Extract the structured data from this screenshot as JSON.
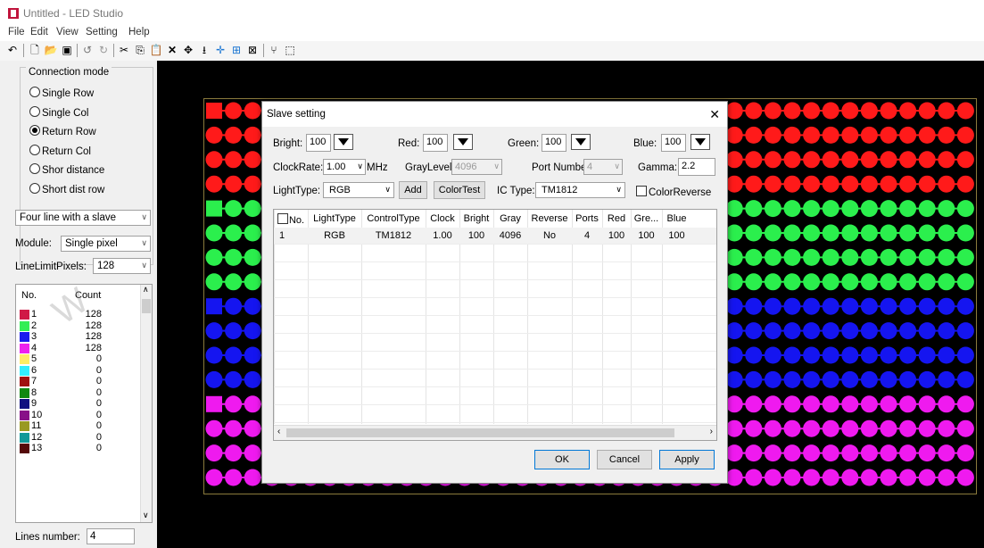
{
  "window": {
    "title": "Untitled - LED Studio"
  },
  "menu": [
    "File",
    "Edit",
    "View",
    "Setting",
    "Help"
  ],
  "toolbar_icons": [
    "undo-icon",
    "new-file-icon",
    "open-folder-icon",
    "save-icon",
    "redo-back-icon",
    "redo-forward-icon",
    "cut-icon",
    "copy-icon",
    "paste-icon",
    "delete-icon",
    "move-icon",
    "arrow-down-icon",
    "crosshair-icon",
    "grid-icon",
    "select-box-icon",
    "binoculars-icon",
    "screen-icon"
  ],
  "left": {
    "connection_mode_label": "Connection mode",
    "modes": [
      {
        "label": "Single Row",
        "checked": false
      },
      {
        "label": "Single Col",
        "checked": false
      },
      {
        "label": "Return Row",
        "checked": true
      },
      {
        "label": "Return Col",
        "checked": false
      },
      {
        "label": "Shor distance",
        "checked": false
      },
      {
        "label": "Short dist row",
        "checked": false
      }
    ],
    "line_mode": "Four line with a slave",
    "module_label": "Module:",
    "module_value": "Single pixel",
    "line_limit_label": "LineLimitPixels:",
    "line_limit_value": "128",
    "list_headers": {
      "no": "No.",
      "count": "Count"
    },
    "list_rows": [
      {
        "no": "1",
        "count": "128",
        "color": "#d01846"
      },
      {
        "no": "2",
        "count": "128",
        "color": "#33ee55"
      },
      {
        "no": "3",
        "count": "128",
        "color": "#1a1aee"
      },
      {
        "no": "4",
        "count": "128",
        "color": "#ee22ee"
      },
      {
        "no": "5",
        "count": "0",
        "color": "#ffee66"
      },
      {
        "no": "6",
        "count": "0",
        "color": "#33eeff"
      },
      {
        "no": "7",
        "count": "0",
        "color": "#a01010"
      },
      {
        "no": "8",
        "count": "0",
        "color": "#118811"
      },
      {
        "no": "9",
        "count": "0",
        "color": "#101080"
      },
      {
        "no": "10",
        "count": "0",
        "color": "#881188"
      },
      {
        "no": "11",
        "count": "0",
        "color": "#999922"
      },
      {
        "no": "12",
        "count": "0",
        "color": "#119999"
      },
      {
        "no": "13",
        "count": "0",
        "color": "#550a0a"
      }
    ],
    "lines_number_label": "Lines number:",
    "lines_number_value": "4"
  },
  "led": {
    "rows": [
      {
        "color": "#ff1a1a"
      },
      {
        "color": "#ff1a1a"
      },
      {
        "color": "#ff1a1a"
      },
      {
        "color": "#ff1a1a"
      },
      {
        "color": "#2bef4d"
      },
      {
        "color": "#2bef4d"
      },
      {
        "color": "#2bef4d"
      },
      {
        "color": "#2bef4d"
      },
      {
        "color": "#1515f0"
      },
      {
        "color": "#1515f0"
      },
      {
        "color": "#1515f0"
      },
      {
        "color": "#1515f0"
      },
      {
        "color": "#ef1aef"
      },
      {
        "color": "#ef1aef"
      },
      {
        "color": "#ef1aef"
      },
      {
        "color": "#ef1aef"
      }
    ],
    "columns": 40
  },
  "dialog": {
    "title": "Slave setting",
    "bright_label": "Bright:",
    "bright_value": "100",
    "red_label": "Red:",
    "red_value": "100",
    "green_label": "Green:",
    "green_value": "100",
    "blue_label": "Blue:",
    "blue_value": "100",
    "clockrate_label": "ClockRate:",
    "clockrate_value": "1.00",
    "clockrate_unit": "MHz",
    "graylevel_label": "GrayLevel:",
    "graylevel_value": "4096",
    "portnumber_label": "Port Number:",
    "portnumber_value": "4",
    "gamma_label": "Gamma:",
    "gamma_value": "2.2",
    "lighttype_label": "LightType:",
    "lighttype_value": "RGB",
    "add_label": "Add",
    "colortest_label": "ColorTest",
    "ictype_label": "IC Type:",
    "ictype_value": "TM1812",
    "colorreverse_label": "ColorReverse",
    "grid_headers": [
      "No.",
      "LightType",
      "ControlType",
      "Clock",
      "Bright",
      "Gray",
      "Reverse",
      "Ports",
      "Red",
      "Gre...",
      "Blue"
    ],
    "grid_rows": [
      [
        "1",
        "RGB",
        "TM1812",
        "1.00",
        "100",
        "4096",
        "No",
        "4",
        "100",
        "100",
        "100"
      ]
    ],
    "ok_label": "OK",
    "cancel_label": "Cancel",
    "apply_label": "Apply"
  }
}
